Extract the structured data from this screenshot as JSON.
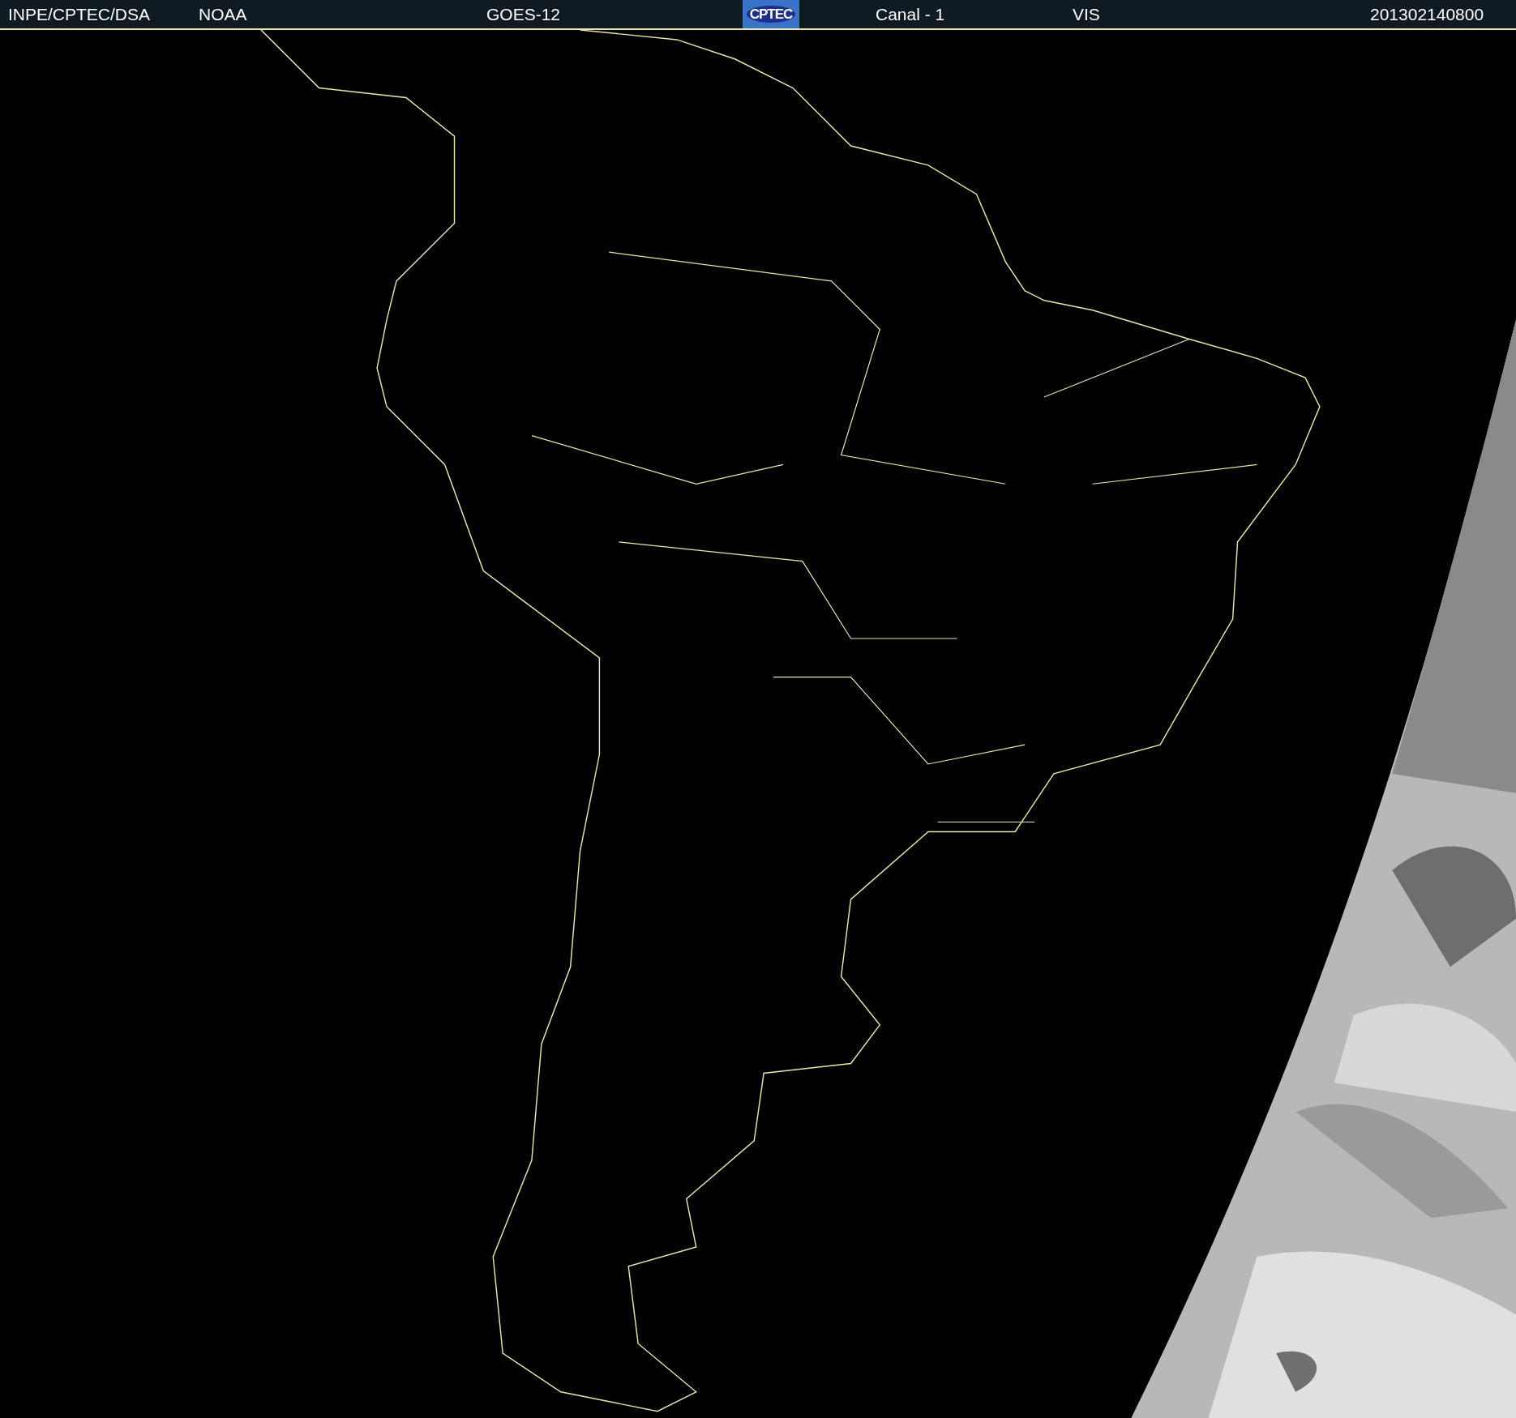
{
  "header": {
    "items": [
      {
        "kind": "text",
        "text": "INPE/CPTEC/DSA"
      },
      {
        "kind": "text",
        "text": "NOAA"
      },
      {
        "kind": "text",
        "text": "GOES-12"
      },
      {
        "kind": "logo",
        "text": "CPTEC"
      },
      {
        "kind": "text",
        "text": "Canal - 1"
      },
      {
        "kind": "text",
        "text": "VIS"
      },
      {
        "kind": "text",
        "text": "201302140800"
      }
    ]
  }
}
